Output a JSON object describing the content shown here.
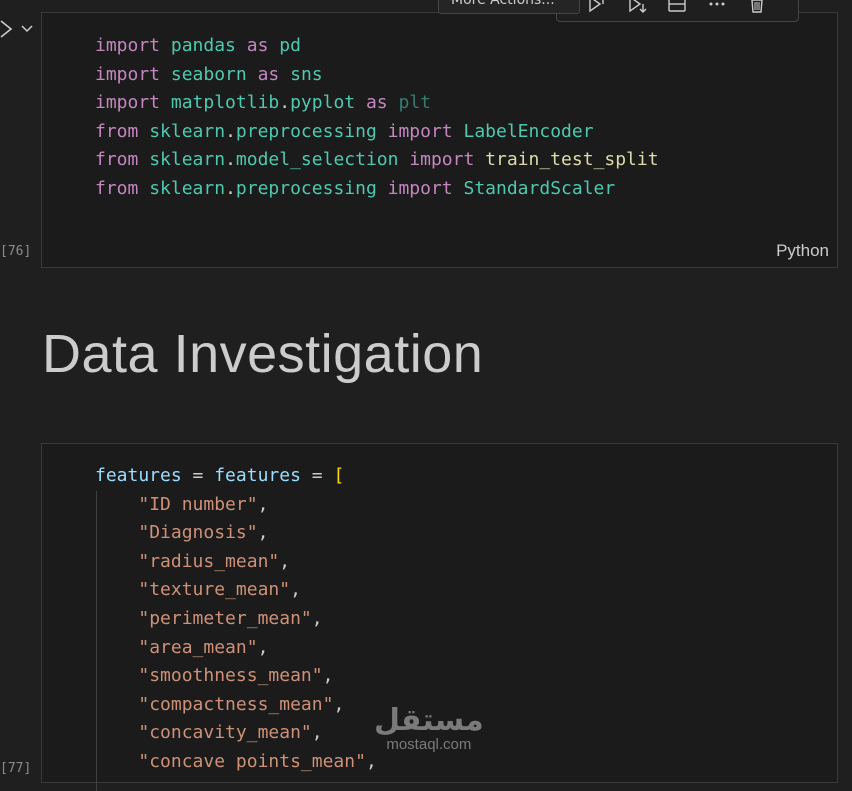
{
  "toolbar": {
    "tooltip": "More Actions...",
    "icons": [
      "run-above-icon",
      "run-below-icon",
      "split-cell-icon",
      "more-icon",
      "delete-icon"
    ]
  },
  "cell1": {
    "exec_count": "[76]",
    "language": "Python",
    "lines": [
      [
        {
          "t": "import",
          "c": "kw"
        },
        {
          "t": " pandas ",
          "c": "mod"
        },
        {
          "t": "as",
          "c": "kw"
        },
        {
          "t": " pd",
          "c": "mod"
        }
      ],
      [
        {
          "t": "import",
          "c": "kw"
        },
        {
          "t": " seaborn ",
          "c": "mod"
        },
        {
          "t": "as",
          "c": "kw"
        },
        {
          "t": " sns",
          "c": "mod"
        }
      ],
      [
        {
          "t": "import",
          "c": "kw"
        },
        {
          "t": " matplotlib",
          "c": "mod"
        },
        {
          "t": ".",
          "c": "plain"
        },
        {
          "t": "pyplot ",
          "c": "mod"
        },
        {
          "t": "as",
          "c": "kw"
        },
        {
          "t": " plt",
          "c": "plt"
        }
      ],
      [
        {
          "t": "from",
          "c": "kw"
        },
        {
          "t": " sklearn",
          "c": "mod"
        },
        {
          "t": ".",
          "c": "plain"
        },
        {
          "t": "preprocessing ",
          "c": "mod"
        },
        {
          "t": "import",
          "c": "kw"
        },
        {
          "t": " LabelEncoder",
          "c": "mod"
        }
      ],
      [
        {
          "t": "from",
          "c": "kw"
        },
        {
          "t": " sklearn",
          "c": "mod"
        },
        {
          "t": ".",
          "c": "plain"
        },
        {
          "t": "model_selection ",
          "c": "mod"
        },
        {
          "t": "import",
          "c": "kw"
        },
        {
          "t": " train_test_split",
          "c": "fn"
        }
      ],
      [
        {
          "t": "from",
          "c": "kw"
        },
        {
          "t": " sklearn",
          "c": "mod"
        },
        {
          "t": ".",
          "c": "plain"
        },
        {
          "t": "preprocessing ",
          "c": "mod"
        },
        {
          "t": "import",
          "c": "kw"
        },
        {
          "t": " StandardScaler",
          "c": "mod"
        }
      ]
    ]
  },
  "heading": "Data Investigation",
  "cell2": {
    "exec_count": "[77]",
    "first_line": [
      {
        "t": "features",
        "c": "var"
      },
      {
        "t": " = ",
        "c": "plain"
      },
      {
        "t": "features",
        "c": "var"
      },
      {
        "t": " = ",
        "c": "plain"
      },
      {
        "t": "[",
        "c": "bracket"
      }
    ],
    "items": [
      "\"ID number\"",
      "\"Diagnosis\"",
      "\"radius_mean\"",
      "\"texture_mean\"",
      "\"perimeter_mean\"",
      "\"area_mean\"",
      "\"smoothness_mean\"",
      "\"compactness_mean\"",
      "\"concavity_mean\"",
      "\"concave points_mean\""
    ]
  },
  "watermark": {
    "main": "مستقل",
    "sub": "mostaql.com"
  }
}
